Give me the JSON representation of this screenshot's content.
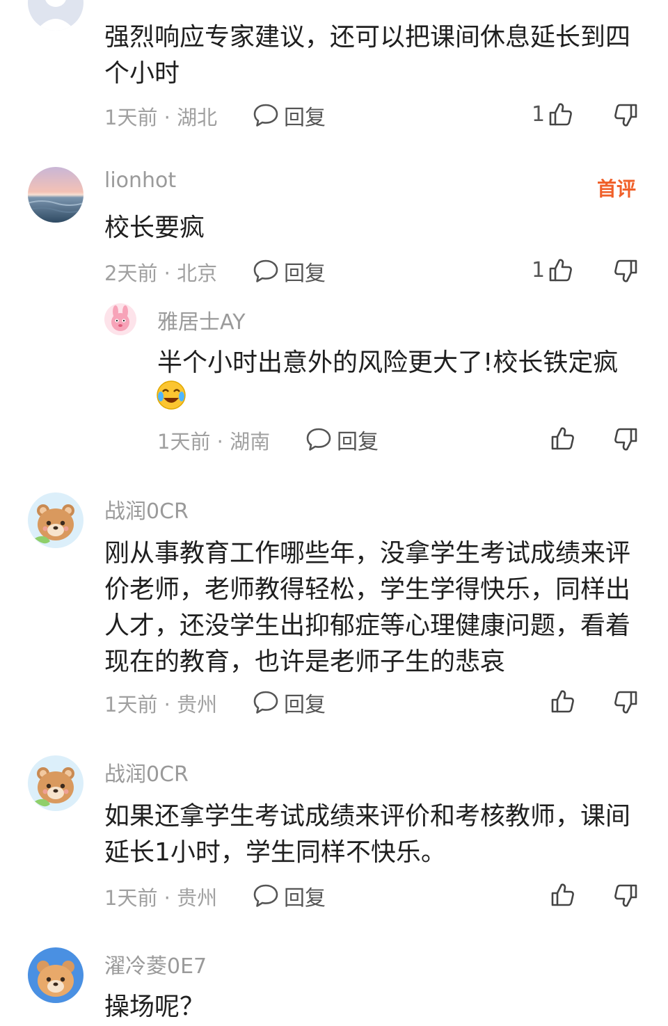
{
  "comments": [
    {
      "content": "强烈响应专家建议，还可以把课间休息延长到四个小时",
      "time_location": "1天前 · 湖北",
      "reply_label": "回复",
      "likes": "1"
    },
    {
      "username": "lionhot",
      "badge": "首评",
      "content": "校长要疯",
      "time_location": "2天前 · 北京",
      "reply_label": "回复",
      "likes": "1",
      "sub_reply": {
        "username": "雅居士AY",
        "content": "半个小时出意外的风险更大了!校长铁定疯",
        "emoji": "laughing-crying-emoji",
        "time_location": "1天前 · 湖南",
        "reply_label": "回复"
      }
    },
    {
      "username": "战润0CR",
      "content": "刚从事教育工作哪些年，没拿学生考试成绩来评价老师，老师教得轻松，学生学得快乐，同样出人才，还没学生出抑郁症等心理健康问题，看着现在的教育，也许是老师子生的悲哀",
      "time_location": "1天前 · 贵州",
      "reply_label": "回复"
    },
    {
      "username": "战润0CR",
      "content": "如果还拿学生考试成绩来评价和考核教师，课间延长1小时，学生同样不快乐。",
      "time_location": "1天前 · 贵州",
      "reply_label": "回复"
    },
    {
      "username": "濯冷菱0E7",
      "content": "操场呢？"
    }
  ],
  "colors": {
    "badge": "#f0602a",
    "meta": "#a0a0a0",
    "text": "#1f1f1f"
  }
}
